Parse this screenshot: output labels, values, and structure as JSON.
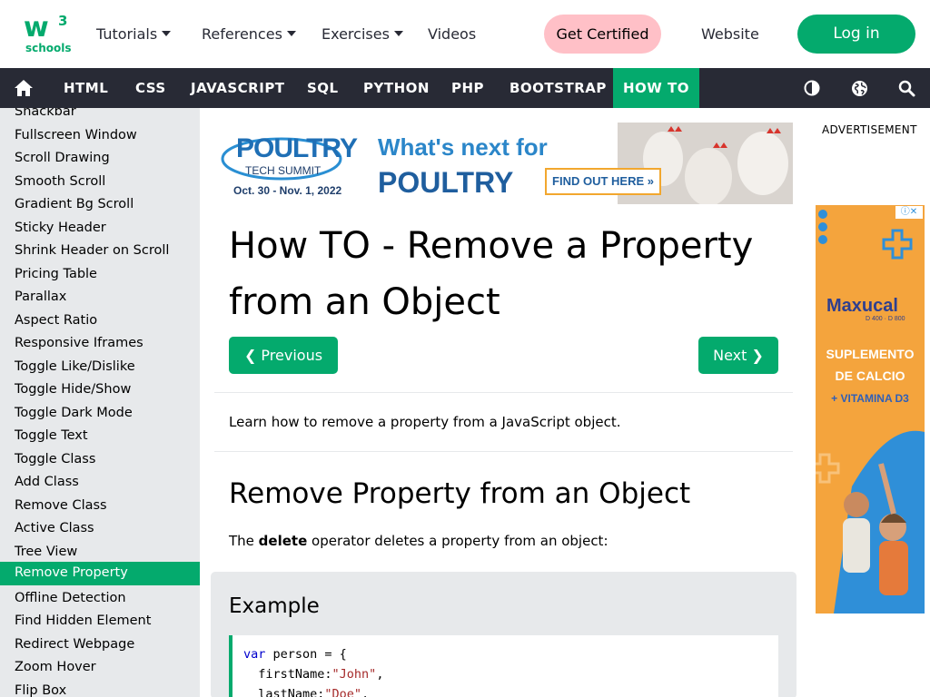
{
  "header": {
    "logo": {
      "main": "w",
      "superscript": "3",
      "sub": "schools"
    },
    "nav": [
      {
        "label": "Tutorials",
        "dropdown": true
      },
      {
        "label": "References",
        "dropdown": true
      },
      {
        "label": "Exercises",
        "dropdown": true
      },
      {
        "label": "Videos",
        "dropdown": false
      }
    ],
    "certified_label": "Get Certified",
    "website_label": "Website",
    "login_label": "Log in"
  },
  "dark_nav": {
    "items": [
      "HTML",
      "CSS",
      "JAVASCRIPT",
      "SQL",
      "PYTHON",
      "PHP",
      "BOOTSTRAP"
    ],
    "active": "HOW TO"
  },
  "sidebar": {
    "items": [
      "Snackbar",
      "Fullscreen Window",
      "Scroll Drawing",
      "Smooth Scroll",
      "Gradient Bg Scroll",
      "Sticky Header",
      "Shrink Header on Scroll",
      "Pricing Table",
      "Parallax",
      "Aspect Ratio",
      "Responsive Iframes",
      "Toggle Like/Dislike",
      "Toggle Hide/Show",
      "Toggle Dark Mode",
      "Toggle Text",
      "Toggle Class",
      "Add Class",
      "Remove Class",
      "Active Class",
      "Tree View",
      "Remove Property",
      "Offline Detection",
      "Find Hidden Element",
      "Redirect Webpage",
      "Zoom Hover",
      "Flip Box"
    ],
    "selected": "Remove Property"
  },
  "banner_ad": {
    "brand": "POULTRY",
    "brand_sub": "TECH SUMMIT",
    "dates": "Oct. 30 - Nov. 1, 2022",
    "headline_1": "What's next for",
    "headline_2": "POULTRY",
    "cta": "FIND OUT HERE »"
  },
  "main": {
    "title": "How TO - Remove a Property from an Object",
    "prev_label": "❮ Previous",
    "next_label": "Next ❯",
    "intro": "Learn how to remove a property from a JavaScript object.",
    "section_title": "Remove Property from an Object",
    "para_prefix": "The ",
    "para_bold": "delete",
    "para_suffix": " operator deletes a property from an object:",
    "example_title": "Example",
    "code": {
      "line1_kw": "var",
      "line1_rest": " person = {",
      "line2_key": "  firstName:",
      "line2_val": "\"John\"",
      "line2_end": ",",
      "line3_key": "  lastName:",
      "line3_val": "\"Doe\"",
      "line3_end": ","
    }
  },
  "right": {
    "advertisement_label": "ADVERTISEMENT",
    "ad_brand": "Maxucal",
    "ad_sub": "D 400 · D 800",
    "ad_line1": "SUPLEMENTO",
    "ad_line2": "DE CALCIO",
    "ad_line3": "+ VITAMINA D3"
  },
  "colors": {
    "accent": "#04AA6D",
    "dark_nav": "#282A35",
    "certified_bg": "#FFC0C7",
    "sidebar_bg": "#E7E9EB"
  }
}
